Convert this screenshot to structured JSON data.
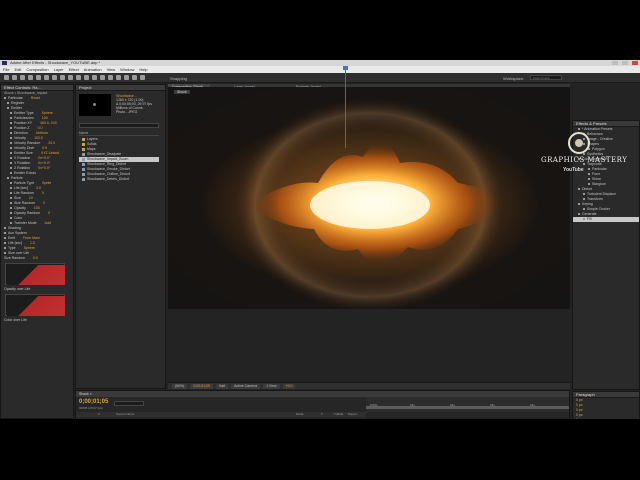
{
  "window": {
    "title": "Adobe After Effects - Shockwave_YOUTUBE.aep *",
    "menus": [
      "File",
      "Edit",
      "Composition",
      "Layer",
      "Effect",
      "Animation",
      "View",
      "Window",
      "Help"
    ]
  },
  "toolbar": {
    "workspace_label": "Workspace:",
    "snapping_label": "Snapping",
    "search_placeholder": "Search Help"
  },
  "effect_controls": {
    "tab": "Effect Controls: Ra...",
    "layer_name": "Shock • Shockwave_Impact",
    "rows": [
      {
        "label": "Particular",
        "value": "Reset",
        "indent": 0
      },
      {
        "label": "Register",
        "value": "",
        "indent": 1
      },
      {
        "label": "Emitter",
        "value": "",
        "indent": 1
      },
      {
        "label": "Emitter Type",
        "value": "Sphere",
        "indent": 2
      },
      {
        "label": "Particles/sec",
        "value": "100",
        "indent": 2
      },
      {
        "label": "Position XY",
        "value": "360.0, 240",
        "indent": 2
      },
      {
        "label": "Position Z",
        "value": "0.0",
        "indent": 2
      },
      {
        "label": "Direction",
        "value": "Uniform",
        "indent": 2
      },
      {
        "label": "Velocity",
        "value": "100.0",
        "indent": 2
      },
      {
        "label": "Velocity Random",
        "value": "20.0",
        "indent": 2
      },
      {
        "label": "Velocity Distr",
        "value": "0.5",
        "indent": 2
      },
      {
        "label": "Emitter Size",
        "value": "XYZ Linked",
        "indent": 2
      },
      {
        "label": "X Rotation",
        "value": "0x+0.0°",
        "indent": 2
      },
      {
        "label": "Y Rotation",
        "value": "0x+0.0°",
        "indent": 2
      },
      {
        "label": "Z Rotation",
        "value": "0x+0.0°",
        "indent": 2
      },
      {
        "label": "Emitter Extras",
        "value": "",
        "indent": 2
      },
      {
        "label": "Particle",
        "value": "",
        "indent": 1
      },
      {
        "label": "Particle Type",
        "value": "Sprite",
        "indent": 2
      },
      {
        "label": "Life [sec]",
        "value": "3.0",
        "indent": 2
      },
      {
        "label": "Life Random",
        "value": "0",
        "indent": 2
      },
      {
        "label": "Size",
        "value": "10",
        "indent": 2
      },
      {
        "label": "Size Random",
        "value": "0",
        "indent": 2
      },
      {
        "label": "Opacity",
        "value": "100",
        "indent": 2
      },
      {
        "label": "Opacity Random",
        "value": "0",
        "indent": 2
      },
      {
        "label": "Color",
        "value": "",
        "indent": 2
      },
      {
        "label": "Transfer Mode",
        "value": "Add",
        "indent": 2
      }
    ],
    "rows_lower": [
      {
        "label": "Shading",
        "value": ""
      },
      {
        "label": "Aux System",
        "value": ""
      },
      {
        "label": "Emit",
        "value": "From Main"
      },
      {
        "label": "Life [sec]",
        "value": "1.0"
      },
      {
        "label": "Type",
        "value": "Sphere"
      },
      {
        "label": "Size over Life",
        "value": ""
      }
    ],
    "graph_rows": [
      {
        "label": "Size Random",
        "value": "0.0"
      },
      {
        "label": "Opacity over Life",
        "value": ""
      },
      {
        "label": "Color over Life",
        "value": ""
      }
    ]
  },
  "project": {
    "tab": "Project",
    "comp_name": "Shockwave...",
    "comp_meta": [
      "1280 x 720 (1.00)",
      "Δ 0;00;05;00, 29.97 fps",
      "Millions of Colors",
      "Photo - JPEG"
    ],
    "search_placeholder": "",
    "column_name": "Name",
    "items": [
      {
        "name": "Layers",
        "type": "folder",
        "selected": false
      },
      {
        "name": "Solids",
        "type": "folder",
        "selected": false
      },
      {
        "name": "Maps",
        "type": "folder",
        "selected": false
      },
      {
        "name": "Shockwave_Dissipate",
        "type": "comp",
        "selected": false
      },
      {
        "name": "Shockwave_Impact_Boom",
        "type": "comp",
        "selected": true
      },
      {
        "name": "Shockwave_Ring_Distort",
        "type": "comp",
        "selected": false
      },
      {
        "name": "Shockwave_Smoke_Distort",
        "type": "comp",
        "selected": false
      },
      {
        "name": "Shockwave_Outline_Distort",
        "type": "comp",
        "selected": false
      },
      {
        "name": "Shockwave_Debris_Distort",
        "type": "comp",
        "selected": false
      }
    ]
  },
  "composition": {
    "tabs": [
      {
        "label": "Composition: Shock...",
        "active": true
      },
      {
        "label": "Layer: (none)",
        "active": false
      },
      {
        "label": "Footage: (none)",
        "active": false
      }
    ],
    "sub_tab": "Shock",
    "bottom_bar": [
      "(50%)",
      "0;00;01;05",
      "Half",
      "Active Camera",
      "1 View",
      "+0.0"
    ]
  },
  "timeline": {
    "tab": "Shock ×",
    "timecode": "0;00;01;05",
    "fps": "00035 (29.97 fps)",
    "columns": [
      "#",
      "Source Name",
      "Mode",
      "T",
      "TrkMat",
      "Parent"
    ],
    "ruler_ticks": [
      "0:00s",
      "01s",
      "02s",
      "03s",
      "04s",
      "05s"
    ],
    "playhead_pos": 0.27,
    "layers": [
      {
        "num": "1",
        "name": "[Shock]",
        "mode": "Normal",
        "color": "#c83c3c"
      },
      {
        "num": "2",
        "name": "[Shock]",
        "mode": "Normal",
        "color": "#c83c3c"
      },
      {
        "num": "",
        "name": "▸ Effects",
        "mode": "",
        "color": ""
      },
      {
        "num": "",
        "name": "▸ fx Shift Channels",
        "mode": "",
        "color": ""
      },
      {
        "num": "",
        "name": "▸ Blend",
        "mode": "",
        "color": ""
      },
      {
        "num": "",
        "name": "⊙ Strength",
        "mode": "",
        "color": ""
      },
      {
        "num": "3",
        "name": "Shockwave_Impact_Boom",
        "mode": "Normal",
        "color": "#9aa0a6"
      },
      {
        "num": "4",
        "name": "Shockwave_Smoke_Distort",
        "mode": "Normal",
        "color": "#9aa0a6"
      },
      {
        "num": "5",
        "name": "Shockwave_Ring_Distort",
        "mode": "Normal",
        "color": "#9aa0a6"
      }
    ]
  },
  "effects_presets": {
    "tab": "Effects & Presets",
    "items": [
      {
        "label": "* Animation Presets",
        "level": 0
      },
      {
        "label": "Behaviors",
        "level": 1
      },
      {
        "label": "Image - Creative",
        "level": 1
      },
      {
        "label": "Shapes",
        "level": 1
      },
      {
        "label": "Polygon",
        "level": 2
      },
      {
        "label": "Synthetics",
        "level": 1
      },
      {
        "label": "Color Correction",
        "level": 0
      },
      {
        "label": "Trapcode",
        "level": 1
      },
      {
        "label": "Particular",
        "level": 2
      },
      {
        "label": "Form",
        "level": 2
      },
      {
        "label": "Shine",
        "level": 2
      },
      {
        "label": "Starglow",
        "level": 2
      },
      {
        "label": "Distort",
        "level": 0
      },
      {
        "label": "Turbulent Displace",
        "level": 1
      },
      {
        "label": "Transform",
        "level": 1
      },
      {
        "label": "Keying",
        "level": 0
      },
      {
        "label": "Simple Choker",
        "level": 1
      },
      {
        "label": "Generate",
        "level": 0
      },
      {
        "label": "Fill",
        "level": 1,
        "selected": true
      }
    ]
  },
  "paragraph": {
    "tab": "Paragraph",
    "values": [
      "0 px",
      "0 px",
      "0 px",
      "0 px",
      "0 px"
    ]
  },
  "watermark": {
    "brand": "GRAPHICS MASTERY",
    "sub": "YouTube"
  },
  "colors": {
    "accent": "#e0a33a",
    "panel": "#2a2a2a",
    "red_bar": "#b5323b",
    "playhead": "#e03030"
  }
}
